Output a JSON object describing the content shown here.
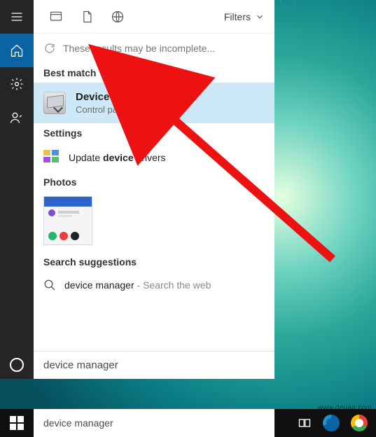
{
  "search_query": "device manager",
  "panel": {
    "filters_label": "Filters",
    "incomplete_msg": "These results may be incomplete...",
    "sections": {
      "best_match": "Best match",
      "settings": "Settings",
      "photos": "Photos",
      "suggestions": "Search suggestions"
    },
    "best": {
      "title": "Device Manager",
      "subtitle": "Control panel"
    },
    "settings_item": {
      "pre": "Update ",
      "bold": "device",
      "post": " drivers"
    },
    "suggestion": {
      "query": "device manager",
      "hint": " - Search the web"
    }
  },
  "watermark": "www.deuaq.com",
  "rail_icons": [
    "menu",
    "home",
    "settings",
    "contact",
    "cortana"
  ],
  "scope_icons": [
    "apps",
    "documents",
    "web"
  ],
  "taskbar_icons": [
    "start",
    "task-view",
    "edge",
    "chrome"
  ]
}
